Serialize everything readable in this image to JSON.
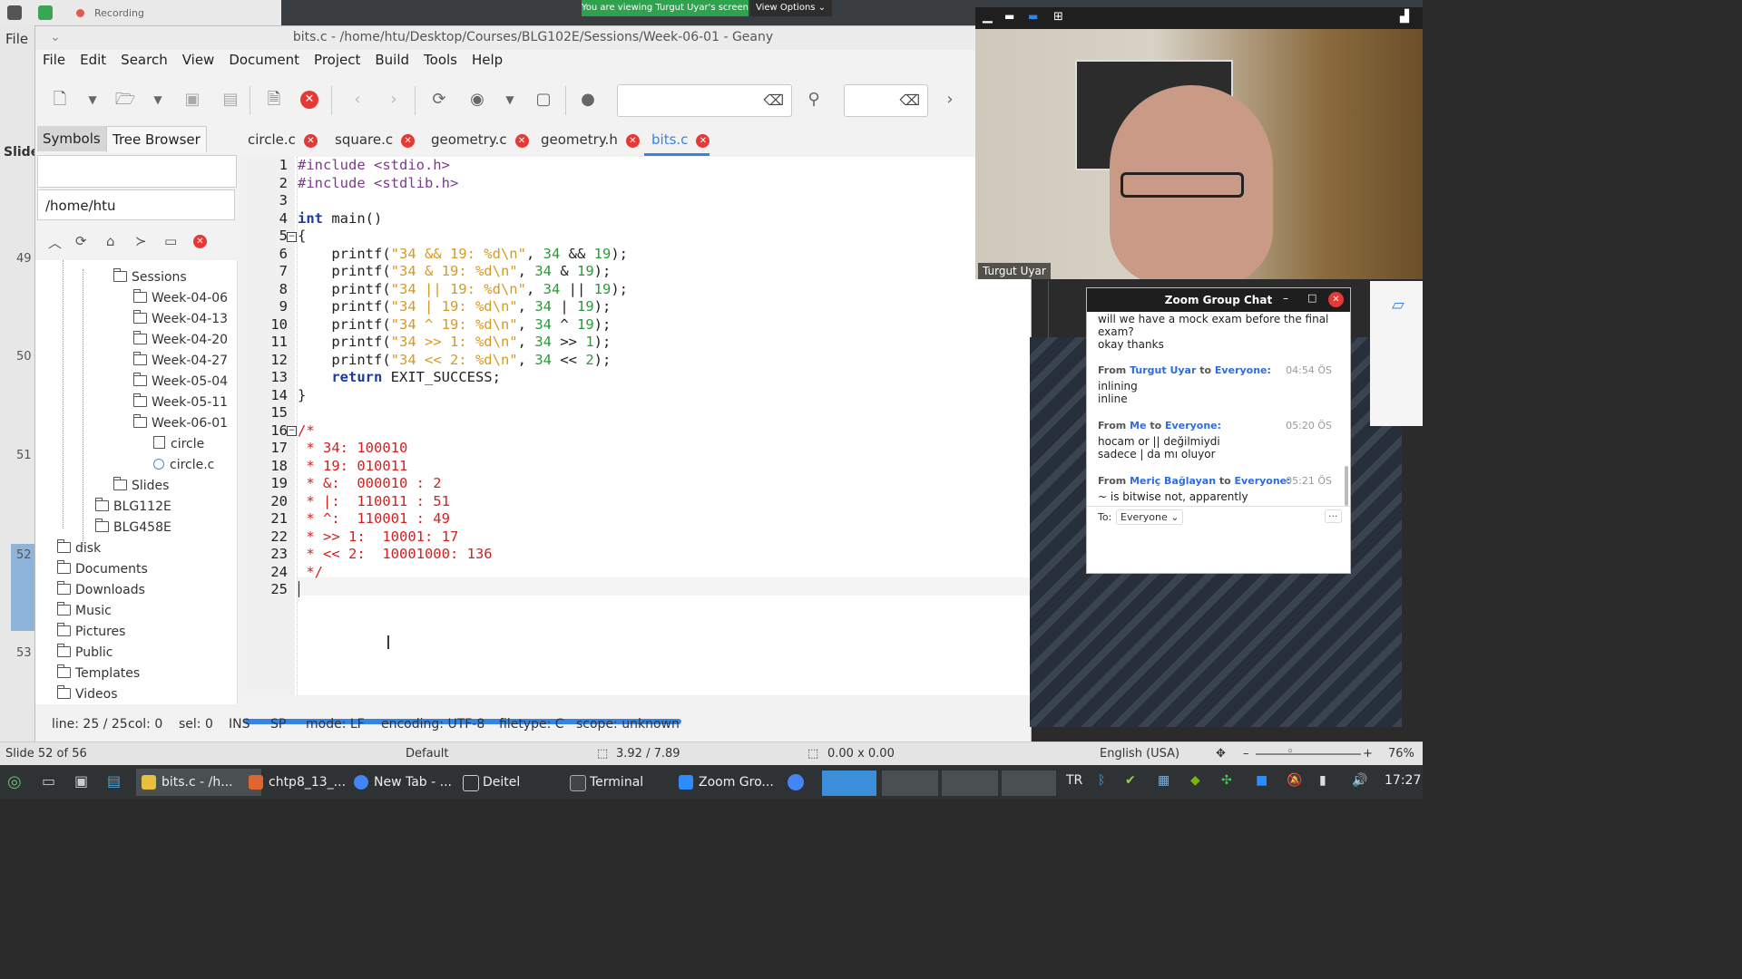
{
  "zoom": {
    "recording_label": "Recording",
    "viewing_banner": "You are viewing Turgut Uyar's screen",
    "view_options": "View Options",
    "participant_name": "Turgut Uyar"
  },
  "background_app": {
    "menu_file": "File",
    "slide_label": "Slide",
    "slide_numbers": [
      "49",
      "50",
      "51",
      "52",
      "53"
    ]
  },
  "geany": {
    "title": "bits.c - /home/htu/Desktop/Courses/BLG102E/Sessions/Week-06-01 - Geany",
    "menu": [
      "File",
      "Edit",
      "Search",
      "View",
      "Document",
      "Project",
      "Build",
      "Tools",
      "Help"
    ],
    "sidebar_tabs": [
      "Symbols",
      "Tree Browser"
    ],
    "sidebar_path": "/home/htu",
    "tree": [
      {
        "label": "Sessions",
        "type": "folder"
      },
      {
        "label": "Week-04-06",
        "type": "folder"
      },
      {
        "label": "Week-04-13",
        "type": "folder"
      },
      {
        "label": "Week-04-20",
        "type": "folder"
      },
      {
        "label": "Week-04-27",
        "type": "folder"
      },
      {
        "label": "Week-05-04",
        "type": "folder"
      },
      {
        "label": "Week-05-11",
        "type": "folder"
      },
      {
        "label": "Week-06-01",
        "type": "folder"
      },
      {
        "label": "circle",
        "type": "file"
      },
      {
        "label": "circle.c",
        "type": "file"
      },
      {
        "label": "Slides",
        "type": "folder"
      },
      {
        "label": "BLG112E",
        "type": "folder"
      },
      {
        "label": "BLG458E",
        "type": "folder"
      },
      {
        "label": "disk",
        "type": "folder"
      },
      {
        "label": "Documents",
        "type": "folder"
      },
      {
        "label": "Downloads",
        "type": "folder"
      },
      {
        "label": "Music",
        "type": "folder"
      },
      {
        "label": "Pictures",
        "type": "folder"
      },
      {
        "label": "Public",
        "type": "folder"
      },
      {
        "label": "Templates",
        "type": "folder"
      },
      {
        "label": "Videos",
        "type": "folder"
      }
    ],
    "tabs": [
      "circle.c",
      "square.c",
      "geometry.c",
      "geometry.h",
      "bits.c"
    ],
    "active_tab": "bits.c",
    "line_numbers": [
      "1",
      "2",
      "3",
      "4",
      "5",
      "6",
      "7",
      "8",
      "9",
      "10",
      "11",
      "12",
      "13",
      "14",
      "15",
      "16",
      "17",
      "18",
      "19",
      "20",
      "21",
      "22",
      "23",
      "24",
      "25"
    ],
    "code": {
      "l1": "#include <stdio.h>",
      "l2": "#include <stdlib.h>",
      "l4_kw": "int",
      "l4_rest": " main()",
      "l5": "{",
      "l6_fn": "    printf(",
      "l6_str": "\"34 && 19: %d\\n\"",
      "l6_rest": ", ",
      "l6_n1": "34",
      "l6_op": " && ",
      "l6_n2": "19",
      "l6_end": ");",
      "l7_str": "\"34 & 19: %d\\n\"",
      "l7_op": " & ",
      "l8_str": "\"34 || 19: %d\\n\"",
      "l8_op": " || ",
      "l9_str": "\"34 | 19: %d\\n\"",
      "l9_op": " | ",
      "l10_str": "\"34 ^ 19: %d\\n\"",
      "l10_op": " ^ ",
      "l11_str": "\"34 >> 1: %d\\n\"",
      "l11_op": " >> ",
      "l11_n2": "1",
      "l12_str": "\"34 << 2: %d\\n\"",
      "l12_op": " << ",
      "l12_n2": "2",
      "l13_kw": "    return",
      "l13_rest": " EXIT_SUCCESS;",
      "l14": "}",
      "l16": "/*",
      "l17": " * 34: 100010",
      "l18": " * 19: 010011",
      "l19": " * &:  000010 : 2",
      "l20": " * |:  110011 : 51",
      "l21": " * ^:  110001 : 49",
      "l22": " * >> 1:  10001: 17",
      "l23": " * << 2:  10001000: 136",
      "l24": " */"
    },
    "status": {
      "line": "line: 25 / 25",
      "col": "col: 0",
      "sel": "sel: 0",
      "ins": "INS",
      "sp": "SP",
      "mode": "mode: LF",
      "encoding": "encoding: UTF-8",
      "filetype": "filetype: C",
      "scope": "scope: unknown"
    }
  },
  "chat": {
    "title": "Zoom Group Chat",
    "partial_line1": "will we have a mock exam before the final",
    "partial_line2": "exam?",
    "partial_line3": "okay thanks",
    "messages": [
      {
        "from_word": "From",
        "sender": "Turgut Uyar",
        "to_word": "to",
        "recipient": "Everyone:",
        "time": "04:54 ÖS",
        "lines": [
          "inlining",
          "inline"
        ]
      },
      {
        "from_word": "From",
        "sender": "Me",
        "to_word": "to",
        "recipient": "Everyone:",
        "time": "05:20 ÖS",
        "lines": [
          "hocam or || değilmiydi",
          "sadece | da mı oluyor"
        ]
      },
      {
        "from_word": "From",
        "sender": "Meriç Bağlayan",
        "to_word": "to",
        "recipient": "Everyone:",
        "time": "05:21 ÖS",
        "lines": [
          "~ is bitwise not, apparently"
        ]
      }
    ],
    "to_label": "To:",
    "to_value": "Everyone",
    "more": "···"
  },
  "impress_bar": {
    "slide": "Slide 52 of 56",
    "layout": "Default",
    "position": "3.92 / 7.89",
    "size": "0.00 x 0.00",
    "language": "English (USA)",
    "zoom": "76%"
  },
  "taskbar": {
    "items": [
      "bits.c - /h...",
      "chtp8_13_...",
      "New Tab - ...",
      "Deitel",
      "Terminal",
      "Zoom Gro..."
    ],
    "keyboard": "TR",
    "clock": "17:27"
  },
  "colors": {
    "accent": "#3584e4",
    "close_red": "#e53935",
    "comment_red": "#d42020",
    "string_orange": "#d69a24",
    "number_green": "#2b9a3a",
    "keyword_blue": "#1b3aa6"
  }
}
